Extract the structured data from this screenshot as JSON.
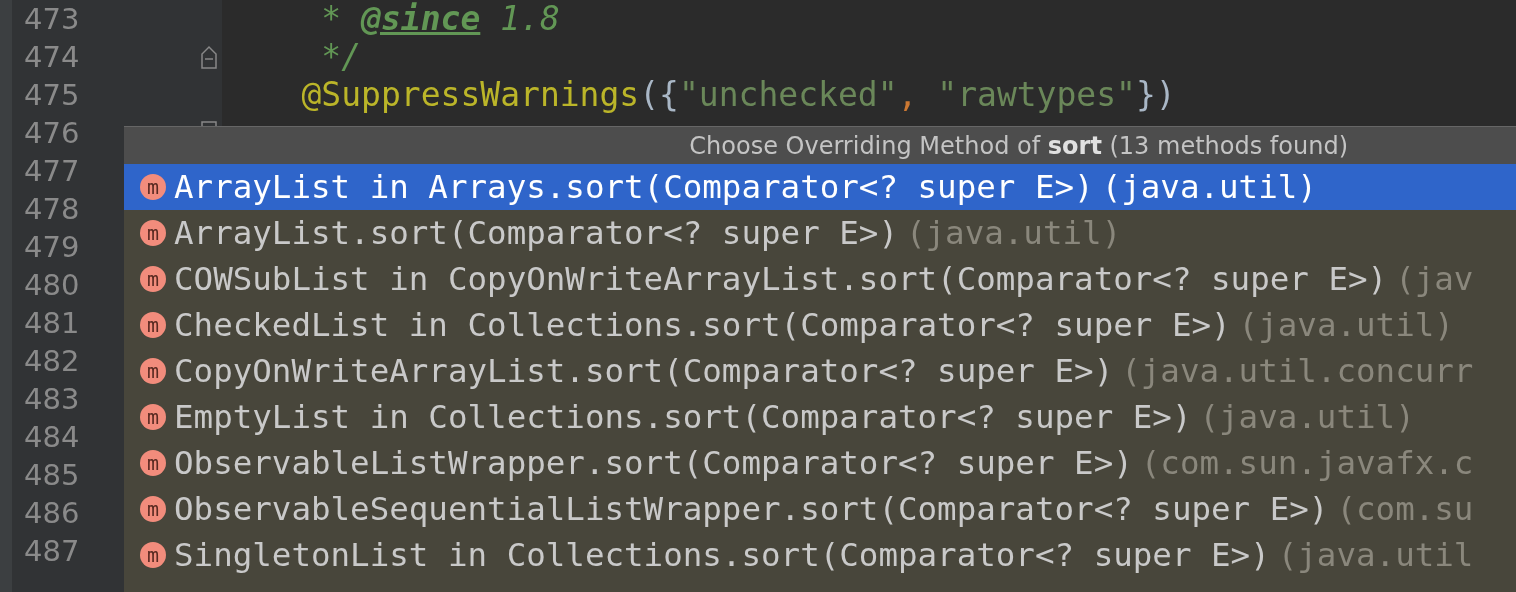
{
  "editor": {
    "lines": [
      {
        "number": "473",
        "tokens": [
          {
            "kind": "comment",
            "text": "     * "
          },
          {
            "kind": "doctag",
            "text": "@since"
          },
          {
            "kind": "comment",
            "text": " 1.8"
          }
        ]
      },
      {
        "number": "474",
        "fold_end": true,
        "tokens": [
          {
            "kind": "comment",
            "text": "     */"
          }
        ]
      },
      {
        "number": "475",
        "tokens": [
          {
            "kind": "annotation",
            "text": "    @SuppressWarnings"
          },
          {
            "kind": "plain",
            "text": "({"
          },
          {
            "kind": "string",
            "text": "\"unchecked\""
          },
          {
            "kind": "keyword",
            "text": ", "
          },
          {
            "kind": "string",
            "text": "\"rawtypes\""
          },
          {
            "kind": "plain",
            "text": "})"
          }
        ]
      },
      {
        "number": "476",
        "fold_start": true
      },
      {
        "number": "477"
      },
      {
        "number": "478"
      },
      {
        "number": "479"
      },
      {
        "number": "480"
      },
      {
        "number": "481"
      },
      {
        "number": "482"
      },
      {
        "number": "483"
      },
      {
        "number": "484"
      },
      {
        "number": "485"
      },
      {
        "number": "486"
      },
      {
        "number": "487"
      }
    ]
  },
  "popup": {
    "title": "Choose Overriding Method of **sort** (13 methods found)",
    "items": [
      {
        "icon": "m",
        "signature": "ArrayList in Arrays.sort(Comparator<? super E>)",
        "package": "(java.util)",
        "selected": true
      },
      {
        "icon": "m",
        "signature": "ArrayList.sort(Comparator<? super E>)",
        "package": "(java.util)",
        "selected": false
      },
      {
        "icon": "m",
        "signature": "COWSubList in CopyOnWriteArrayList.sort(Comparator<? super E>)",
        "package": "(jav",
        "selected": false
      },
      {
        "icon": "m",
        "signature": "CheckedList in Collections.sort(Comparator<? super E>)",
        "package": "(java.util)",
        "selected": false
      },
      {
        "icon": "m",
        "signature": "CopyOnWriteArrayList.sort(Comparator<? super E>)",
        "package": "(java.util.concurr",
        "selected": false
      },
      {
        "icon": "m",
        "signature": "EmptyList in Collections.sort(Comparator<? super E>)",
        "package": "(java.util)",
        "selected": false
      },
      {
        "icon": "m",
        "signature": "ObservableListWrapper.sort(Comparator<? super E>)",
        "package": "(com.sun.javafx.c",
        "selected": false
      },
      {
        "icon": "m",
        "signature": "ObservableSequentialListWrapper.sort(Comparator<? super E>)",
        "package": "(com.su",
        "selected": false
      },
      {
        "icon": "m",
        "signature": "SingletonList in Collections.sort(Comparator<? super E>)",
        "package": "(java.util",
        "selected": false
      }
    ]
  }
}
